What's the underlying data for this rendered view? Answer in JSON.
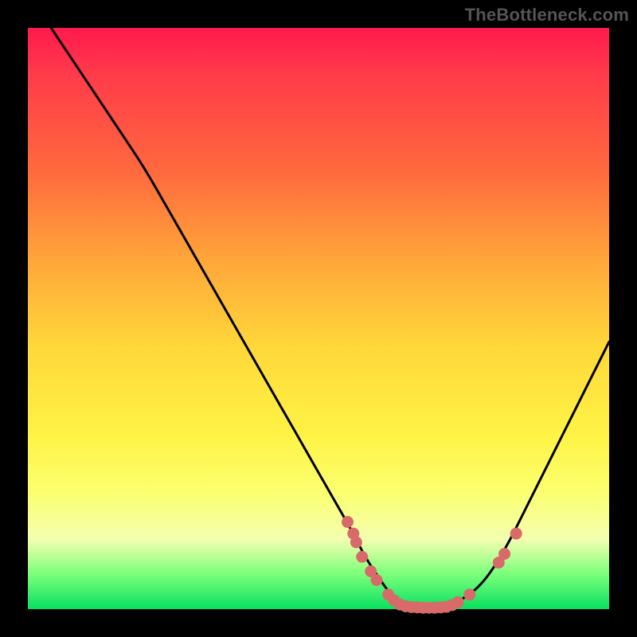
{
  "watermark": "TheBottleneck.com",
  "colors": {
    "background": "#000000",
    "gradient_top": "#ff1a4d",
    "gradient_mid": "#ffe24a",
    "gradient_bottom": "#07e060",
    "curve": "#000000",
    "markers": "#d86a6a"
  },
  "chart_data": {
    "type": "line",
    "title": "",
    "xlabel": "",
    "ylabel": "",
    "xlim": [
      0,
      100
    ],
    "ylim": [
      0,
      100
    ],
    "x": [
      4,
      8,
      12,
      16,
      20,
      24,
      28,
      32,
      36,
      40,
      44,
      48,
      52,
      56,
      58,
      60,
      62,
      64,
      66,
      68,
      70,
      72,
      74,
      78,
      82,
      86,
      90,
      94,
      98,
      100
    ],
    "values": [
      100,
      94,
      88,
      82,
      76,
      69,
      62,
      55,
      48,
      41,
      34,
      27,
      20,
      13,
      9,
      6,
      3,
      1.2,
      0.4,
      0.25,
      0.25,
      0.4,
      1.2,
      4,
      10,
      18,
      26,
      34,
      42,
      46
    ],
    "markers": [
      {
        "x": 55,
        "y": 15
      },
      {
        "x": 56,
        "y": 13
      },
      {
        "x": 56.5,
        "y": 11.5
      },
      {
        "x": 57.5,
        "y": 9
      },
      {
        "x": 59,
        "y": 6.5
      },
      {
        "x": 60,
        "y": 5
      },
      {
        "x": 62,
        "y": 2.5
      },
      {
        "x": 63,
        "y": 1.5
      },
      {
        "x": 64,
        "y": 0.8
      },
      {
        "x": 65,
        "y": 0.5
      },
      {
        "x": 66,
        "y": 0.35
      },
      {
        "x": 67,
        "y": 0.3
      },
      {
        "x": 68,
        "y": 0.25
      },
      {
        "x": 69,
        "y": 0.25
      },
      {
        "x": 70,
        "y": 0.25
      },
      {
        "x": 71,
        "y": 0.3
      },
      {
        "x": 72,
        "y": 0.4
      },
      {
        "x": 73,
        "y": 0.7
      },
      {
        "x": 74,
        "y": 1.2
      },
      {
        "x": 76,
        "y": 2.5
      },
      {
        "x": 81,
        "y": 8
      },
      {
        "x": 82,
        "y": 9.5
      },
      {
        "x": 84,
        "y": 13
      }
    ]
  }
}
